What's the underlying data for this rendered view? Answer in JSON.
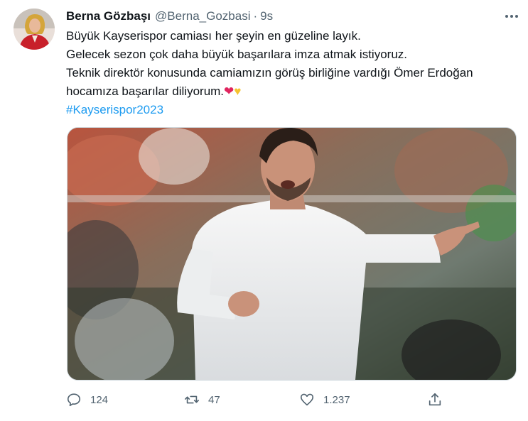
{
  "tweet": {
    "author": {
      "display_name": "Berna Gözbaşı",
      "handle": "@Berna_Gozbasi",
      "separator": "·",
      "timestamp": "9s"
    },
    "text_lines": [
      "Büyük Kayserispor camiası her şeyin en güzeline layık.",
      "Gelecek sezon çok daha büyük başarılara imza atmak istiyoruz.",
      "Teknik direktör konusunda camiamızın görüş birliğine vardığı Ömer Erdoğan",
      "hocamıza başarılar diliyorum."
    ],
    "emoji": {
      "red_heart": "❤",
      "yellow_heart": "♥"
    },
    "hashtag": "#Kayserispor2023",
    "actions": {
      "reply_count": "124",
      "retweet_count": "47",
      "like_count": "1.237"
    },
    "icons": [
      "more-icon",
      "reply-icon",
      "retweet-icon",
      "like-icon",
      "share-icon"
    ],
    "colors": {
      "hashtag": "#1d9bf0",
      "secondary_text": "#536471",
      "primary_text": "#0f1419"
    }
  }
}
